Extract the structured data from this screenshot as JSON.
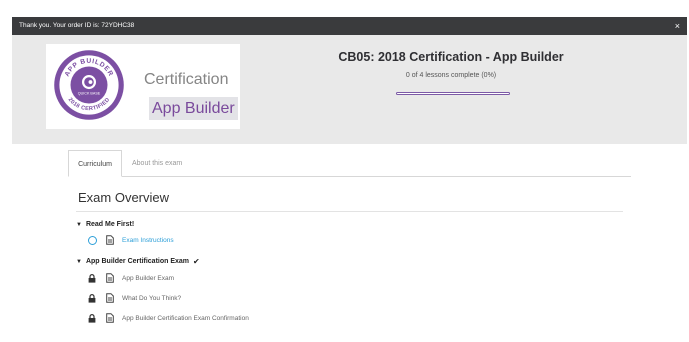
{
  "notice": {
    "text": "Thank you. Your order ID is: 72YDHC38",
    "close_label": "×"
  },
  "badge": {
    "seal_top": "APP BUILDER",
    "seal_bottom": "2018 CERTIFIED",
    "seal_brand": "QUICK BASE",
    "certification_label": "Certification",
    "app_builder_label": "App Builder"
  },
  "course": {
    "title": "CB05: 2018 Certification - App Builder",
    "progress_text": "0 of 4 lessons complete (0%)",
    "progress_fraction": 0
  },
  "tabs": [
    {
      "label": "Curriculum",
      "active": true
    },
    {
      "label": "About this exam",
      "active": false
    }
  ],
  "overview_title": "Exam Overview",
  "sections": [
    {
      "title": "Read Me First!",
      "lessons": [
        {
          "label": "Exam Instructions",
          "status": "available"
        }
      ]
    },
    {
      "title": "App Builder Certification Exam",
      "check": "✔",
      "lessons": [
        {
          "label": "App Builder Exam",
          "status": "locked"
        },
        {
          "label": "What Do You Think?",
          "status": "locked"
        },
        {
          "label": "App Builder Certification Exam Confirmation",
          "status": "locked"
        }
      ]
    }
  ],
  "colors": {
    "accent_purple": "#7c5aa6",
    "link_blue": "#2d9fd8",
    "notice_bg": "#3a3b3d",
    "hero_bg": "#e9e9e9"
  }
}
